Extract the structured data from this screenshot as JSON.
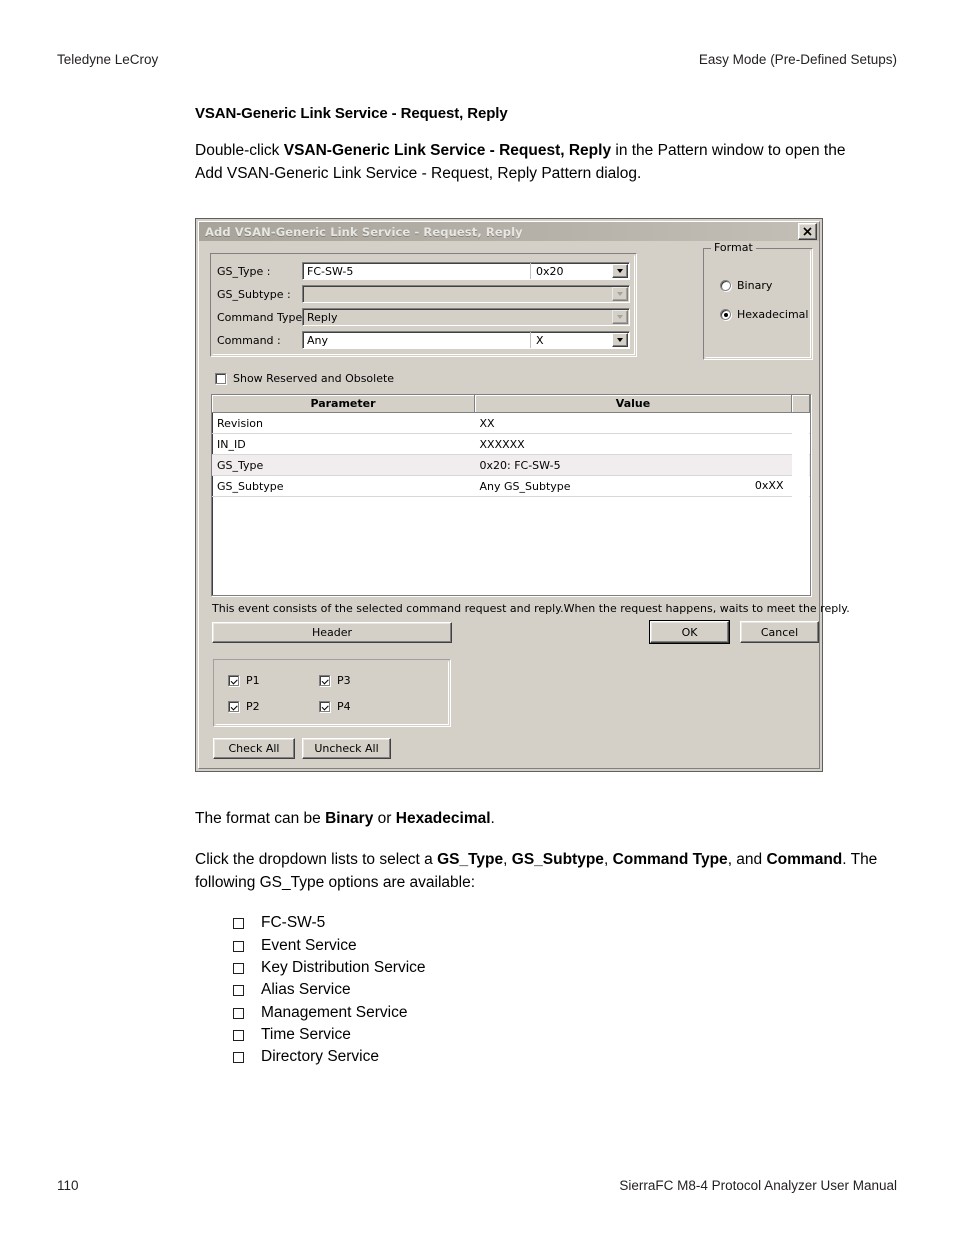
{
  "page": {
    "header_left": "Teledyne LeCroy",
    "header_right": "Easy Mode (Pre-Defined Setups)",
    "footer_left": "110",
    "footer_right": "SierraFC M8-4 Protocol Analyzer User Manual"
  },
  "content": {
    "section_title": "VSAN-Generic Link Service - Request, Reply",
    "intro_pre": "Double-click ",
    "intro_bold": "VSAN-Generic Link Service - Request, Reply",
    "intro_post": " in the Pattern window to open the Add VSAN-Generic Link Service - Request, Reply Pattern dialog.",
    "format_pre": "The format can be ",
    "format_b1": "Binary",
    "format_mid": " or ",
    "format_b2": "Hexadecimal",
    "format_post": ".",
    "dropdown_pre": "Click the dropdown lists to select a ",
    "dropdown_b1": "GS_Type",
    "dropdown_sep1": ", ",
    "dropdown_b2": "GS_Subtype",
    "dropdown_sep2": ", ",
    "dropdown_b3": "Command Type",
    "dropdown_sep3": ", and ",
    "dropdown_b4": "Command",
    "dropdown_post": ". The following GS_Type options are available:",
    "options": [
      "FC-SW-5",
      "Event Service",
      "Key Distribution Service",
      "Alias Service",
      "Management Service",
      "Time Service",
      "Directory Service"
    ]
  },
  "dialog": {
    "title": "Add VSAN-Generic Link Service - Request, Reply",
    "close_icon": "close-icon",
    "fields": [
      {
        "label": "GS_Type :",
        "value": "FC-SW-5",
        "second": "0x20",
        "enabled": true
      },
      {
        "label": "GS_Subtype :",
        "value": "",
        "second": "",
        "enabled": false
      },
      {
        "label": "Command Type:",
        "value": "Reply",
        "second": "",
        "enabled": false
      },
      {
        "label": "Command :",
        "value": "Any",
        "second": "X",
        "enabled": true
      }
    ],
    "format": {
      "legend": "Format",
      "options": [
        {
          "label": "Binary",
          "selected": false
        },
        {
          "label": "Hexadecimal",
          "selected": true
        }
      ]
    },
    "show_reserved": {
      "label": "Show Reserved and Obsolete",
      "checked": false
    },
    "table": {
      "headers": [
        "Parameter",
        "Value"
      ],
      "rows": [
        {
          "parameter": "Revision",
          "value": "XX",
          "value_right": "",
          "highlight": false,
          "dropdown": false
        },
        {
          "parameter": "IN_ID",
          "value": "XXXXXX",
          "value_right": "",
          "highlight": false,
          "dropdown": false
        },
        {
          "parameter": "GS_Type",
          "value": "0x20: FC-SW-5",
          "value_right": "",
          "highlight": true,
          "dropdown": false
        },
        {
          "parameter": "GS_Subtype",
          "value": "Any GS_Subtype",
          "value_right": "0xXX",
          "highlight": false,
          "dropdown": true
        }
      ]
    },
    "description": "This event consists of the selected command request and reply.When the request happens, waits to meet the reply.",
    "buttons": {
      "header": "Header",
      "ok": "OK",
      "cancel": "Cancel",
      "check_all": "Check All",
      "uncheck_all": "Uncheck All"
    },
    "ports": [
      {
        "label": "P1",
        "checked": true
      },
      {
        "label": "P2",
        "checked": true
      },
      {
        "label": "P3",
        "checked": true
      },
      {
        "label": "P4",
        "checked": true
      }
    ]
  }
}
